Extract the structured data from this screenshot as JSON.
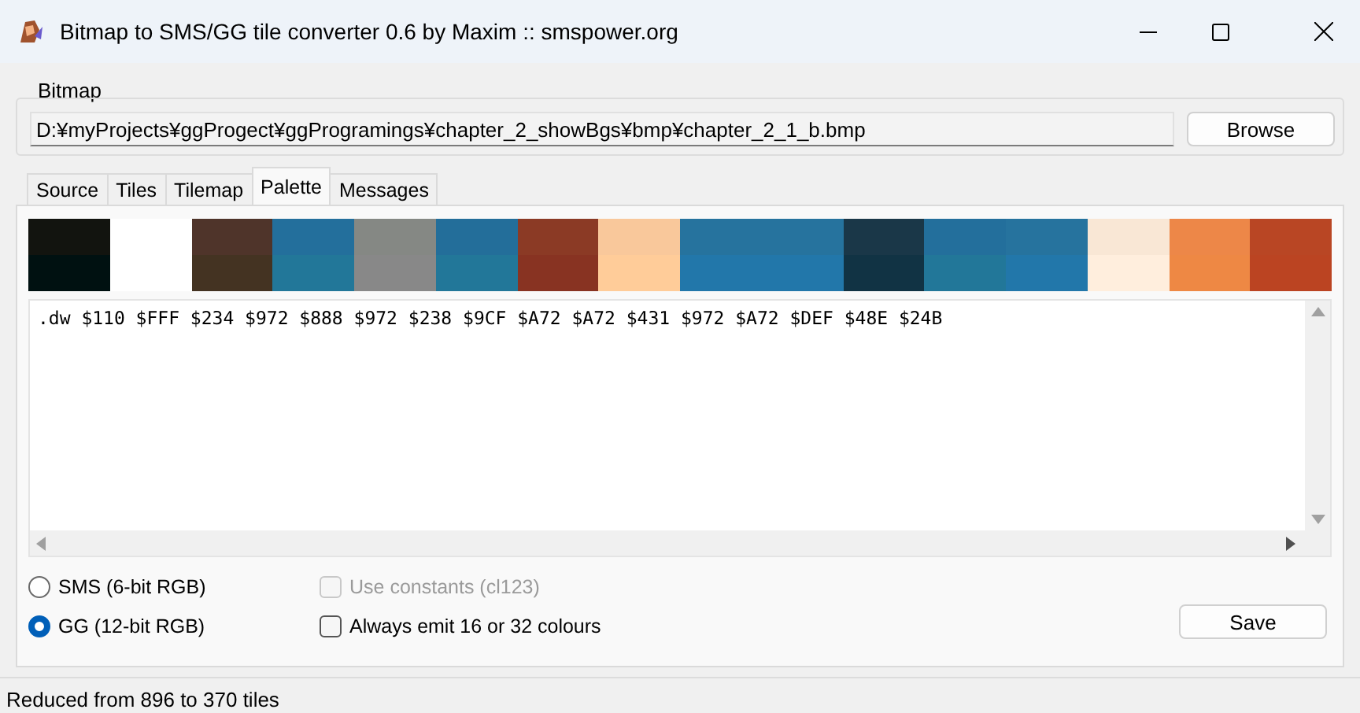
{
  "window": {
    "title": "Bitmap to SMS/GG tile converter 0.6 by Maxim :: smspower.org"
  },
  "bitmap": {
    "label": "Bitmap",
    "path": "D:¥myProjects¥ggProgect¥ggProgramings¥chapter_2_showBgs¥bmp¥chapter_2_1_b.bmp",
    "button": "Browse"
  },
  "tabs": [
    {
      "label": "Source",
      "selected": false
    },
    {
      "label": "Tiles",
      "selected": false
    },
    {
      "label": "Tilemap",
      "selected": false
    },
    {
      "label": "Palette",
      "selected": true
    },
    {
      "label": "Messages",
      "selected": false
    }
  ],
  "source_palette": [
    {
      "color": "#12140f"
    },
    {
      "color": "#ffffff"
    },
    {
      "color": "#4f342a"
    },
    {
      "color": "#236f9c"
    },
    {
      "color": "#858884"
    },
    {
      "color": "#236e9a"
    },
    {
      "color": "#8b3a25"
    },
    {
      "color": "#f9c89b"
    },
    {
      "color": "#26739e"
    },
    {
      "color": "#26739e"
    },
    {
      "color": "#1a3748"
    },
    {
      "color": "#236f9c"
    },
    {
      "color": "#26739e"
    },
    {
      "color": "#f9e7d5"
    },
    {
      "color": "#ed8748"
    },
    {
      "color": "#b94624"
    }
  ],
  "converted_palette": [
    {
      "color": "#001111"
    },
    {
      "color": "#ffffff"
    },
    {
      "color": "#443322"
    },
    {
      "color": "#227799"
    },
    {
      "color": "#888888"
    },
    {
      "color": "#227799"
    },
    {
      "color": "#883322"
    },
    {
      "color": "#ffcc99"
    },
    {
      "color": "#2277aa"
    },
    {
      "color": "#2277aa"
    },
    {
      "color": "#113344"
    },
    {
      "color": "#227799"
    },
    {
      "color": "#2277aa"
    },
    {
      "color": "#ffeedd"
    },
    {
      "color": "#ee8844"
    },
    {
      "color": "#bb4422"
    }
  ],
  "output": ".dw $110 $FFF $234 $972 $888 $972 $238 $9CF $A72 $A72 $431 $972 $A72 $DEF $48E $24B",
  "modes": [
    {
      "label": "SMS (6-bit RGB)",
      "selected": false
    },
    {
      "label": "GG (12-bit RGB)",
      "selected": true
    }
  ],
  "options": [
    {
      "label": "Use constants (cl123)",
      "checked": false,
      "disabled": true
    },
    {
      "label": "Always emit 16 or 32 colours",
      "checked": false,
      "disabled": false
    }
  ],
  "save_button": "Save",
  "status_bar": "Reduced from 896 to 370 tiles"
}
